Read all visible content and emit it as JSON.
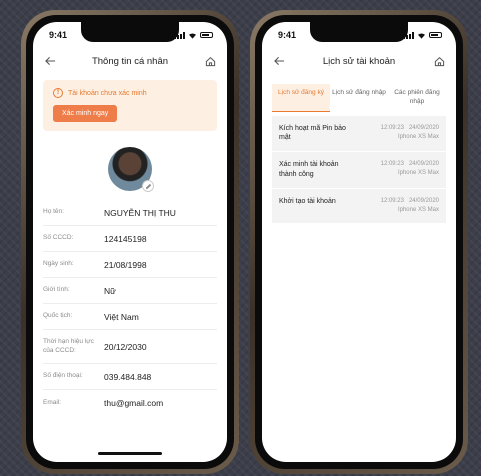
{
  "left_phone": {
    "status": {
      "time": "9:41"
    },
    "nav": {
      "title": "Thông tin cá nhân",
      "back_icon": "arrow-left-icon",
      "home_icon": "home-icon"
    },
    "alert": {
      "text": "Tài khoản chưa xác minh",
      "button_label": "Xác minh ngay",
      "accent": "#e8792f"
    },
    "profile": {
      "fields": [
        {
          "label": "Họ tên:",
          "value": "NGUYỄN THỊ THU"
        },
        {
          "label": "Số CCCD:",
          "value": "124145198"
        },
        {
          "label": "Ngày sinh:",
          "value": "21/08/1998"
        },
        {
          "label": "Giới tính:",
          "value": "Nữ"
        },
        {
          "label": "Quốc tịch:",
          "value": "Việt Nam"
        },
        {
          "label": "Thời hạn hiệu lực của CCCD:",
          "value": "20/12/2030"
        },
        {
          "label": "Số điện thoại:",
          "value": "039.484.848"
        },
        {
          "label": "Email:",
          "value": "thu@gmail.com"
        }
      ]
    }
  },
  "right_phone": {
    "status": {
      "time": "9:41"
    },
    "nav": {
      "title": "Lịch sử tài khoản",
      "back_icon": "arrow-left-icon",
      "home_icon": "home-icon"
    },
    "tabs": [
      {
        "label": "Lịch sử đăng ký",
        "active": true
      },
      {
        "label": "Lịch sử đăng nhập",
        "active": false
      },
      {
        "label": "Các phiên đăng nhập",
        "active": false
      }
    ],
    "history": [
      {
        "title": "Kích hoạt mã Pin bảo mật",
        "time": "12:09:23",
        "date": "24/09/2020",
        "device": "Iphone XS Max"
      },
      {
        "title": "Xác minh tài khoản thành công",
        "time": "12:09:23",
        "date": "24/09/2020",
        "device": "Iphone XS Max"
      },
      {
        "title": "Khởi tạo tài khoản",
        "time": "12:09:23",
        "date": "24/09/2020",
        "device": "Iphone XS Max"
      }
    ]
  }
}
